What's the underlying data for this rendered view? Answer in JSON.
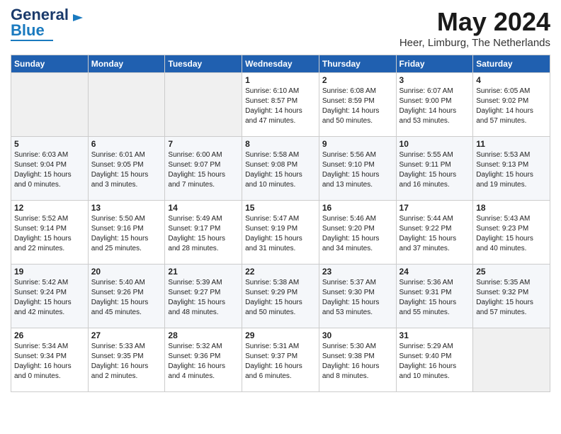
{
  "logo": {
    "text1": "General",
    "text2": "Blue"
  },
  "title": "May 2024",
  "location": "Heer, Limburg, The Netherlands",
  "weekdays": [
    "Sunday",
    "Monday",
    "Tuesday",
    "Wednesday",
    "Thursday",
    "Friday",
    "Saturday"
  ],
  "weeks": [
    [
      {
        "day": "",
        "info": ""
      },
      {
        "day": "",
        "info": ""
      },
      {
        "day": "",
        "info": ""
      },
      {
        "day": "1",
        "info": "Sunrise: 6:10 AM\nSunset: 8:57 PM\nDaylight: 14 hours\nand 47 minutes."
      },
      {
        "day": "2",
        "info": "Sunrise: 6:08 AM\nSunset: 8:59 PM\nDaylight: 14 hours\nand 50 minutes."
      },
      {
        "day": "3",
        "info": "Sunrise: 6:07 AM\nSunset: 9:00 PM\nDaylight: 14 hours\nand 53 minutes."
      },
      {
        "day": "4",
        "info": "Sunrise: 6:05 AM\nSunset: 9:02 PM\nDaylight: 14 hours\nand 57 minutes."
      }
    ],
    [
      {
        "day": "5",
        "info": "Sunrise: 6:03 AM\nSunset: 9:04 PM\nDaylight: 15 hours\nand 0 minutes."
      },
      {
        "day": "6",
        "info": "Sunrise: 6:01 AM\nSunset: 9:05 PM\nDaylight: 15 hours\nand 3 minutes."
      },
      {
        "day": "7",
        "info": "Sunrise: 6:00 AM\nSunset: 9:07 PM\nDaylight: 15 hours\nand 7 minutes."
      },
      {
        "day": "8",
        "info": "Sunrise: 5:58 AM\nSunset: 9:08 PM\nDaylight: 15 hours\nand 10 minutes."
      },
      {
        "day": "9",
        "info": "Sunrise: 5:56 AM\nSunset: 9:10 PM\nDaylight: 15 hours\nand 13 minutes."
      },
      {
        "day": "10",
        "info": "Sunrise: 5:55 AM\nSunset: 9:11 PM\nDaylight: 15 hours\nand 16 minutes."
      },
      {
        "day": "11",
        "info": "Sunrise: 5:53 AM\nSunset: 9:13 PM\nDaylight: 15 hours\nand 19 minutes."
      }
    ],
    [
      {
        "day": "12",
        "info": "Sunrise: 5:52 AM\nSunset: 9:14 PM\nDaylight: 15 hours\nand 22 minutes."
      },
      {
        "day": "13",
        "info": "Sunrise: 5:50 AM\nSunset: 9:16 PM\nDaylight: 15 hours\nand 25 minutes."
      },
      {
        "day": "14",
        "info": "Sunrise: 5:49 AM\nSunset: 9:17 PM\nDaylight: 15 hours\nand 28 minutes."
      },
      {
        "day": "15",
        "info": "Sunrise: 5:47 AM\nSunset: 9:19 PM\nDaylight: 15 hours\nand 31 minutes."
      },
      {
        "day": "16",
        "info": "Sunrise: 5:46 AM\nSunset: 9:20 PM\nDaylight: 15 hours\nand 34 minutes."
      },
      {
        "day": "17",
        "info": "Sunrise: 5:44 AM\nSunset: 9:22 PM\nDaylight: 15 hours\nand 37 minutes."
      },
      {
        "day": "18",
        "info": "Sunrise: 5:43 AM\nSunset: 9:23 PM\nDaylight: 15 hours\nand 40 minutes."
      }
    ],
    [
      {
        "day": "19",
        "info": "Sunrise: 5:42 AM\nSunset: 9:24 PM\nDaylight: 15 hours\nand 42 minutes."
      },
      {
        "day": "20",
        "info": "Sunrise: 5:40 AM\nSunset: 9:26 PM\nDaylight: 15 hours\nand 45 minutes."
      },
      {
        "day": "21",
        "info": "Sunrise: 5:39 AM\nSunset: 9:27 PM\nDaylight: 15 hours\nand 48 minutes."
      },
      {
        "day": "22",
        "info": "Sunrise: 5:38 AM\nSunset: 9:29 PM\nDaylight: 15 hours\nand 50 minutes."
      },
      {
        "day": "23",
        "info": "Sunrise: 5:37 AM\nSunset: 9:30 PM\nDaylight: 15 hours\nand 53 minutes."
      },
      {
        "day": "24",
        "info": "Sunrise: 5:36 AM\nSunset: 9:31 PM\nDaylight: 15 hours\nand 55 minutes."
      },
      {
        "day": "25",
        "info": "Sunrise: 5:35 AM\nSunset: 9:32 PM\nDaylight: 15 hours\nand 57 minutes."
      }
    ],
    [
      {
        "day": "26",
        "info": "Sunrise: 5:34 AM\nSunset: 9:34 PM\nDaylight: 16 hours\nand 0 minutes."
      },
      {
        "day": "27",
        "info": "Sunrise: 5:33 AM\nSunset: 9:35 PM\nDaylight: 16 hours\nand 2 minutes."
      },
      {
        "day": "28",
        "info": "Sunrise: 5:32 AM\nSunset: 9:36 PM\nDaylight: 16 hours\nand 4 minutes."
      },
      {
        "day": "29",
        "info": "Sunrise: 5:31 AM\nSunset: 9:37 PM\nDaylight: 16 hours\nand 6 minutes."
      },
      {
        "day": "30",
        "info": "Sunrise: 5:30 AM\nSunset: 9:38 PM\nDaylight: 16 hours\nand 8 minutes."
      },
      {
        "day": "31",
        "info": "Sunrise: 5:29 AM\nSunset: 9:40 PM\nDaylight: 16 hours\nand 10 minutes."
      },
      {
        "day": "",
        "info": ""
      }
    ]
  ]
}
